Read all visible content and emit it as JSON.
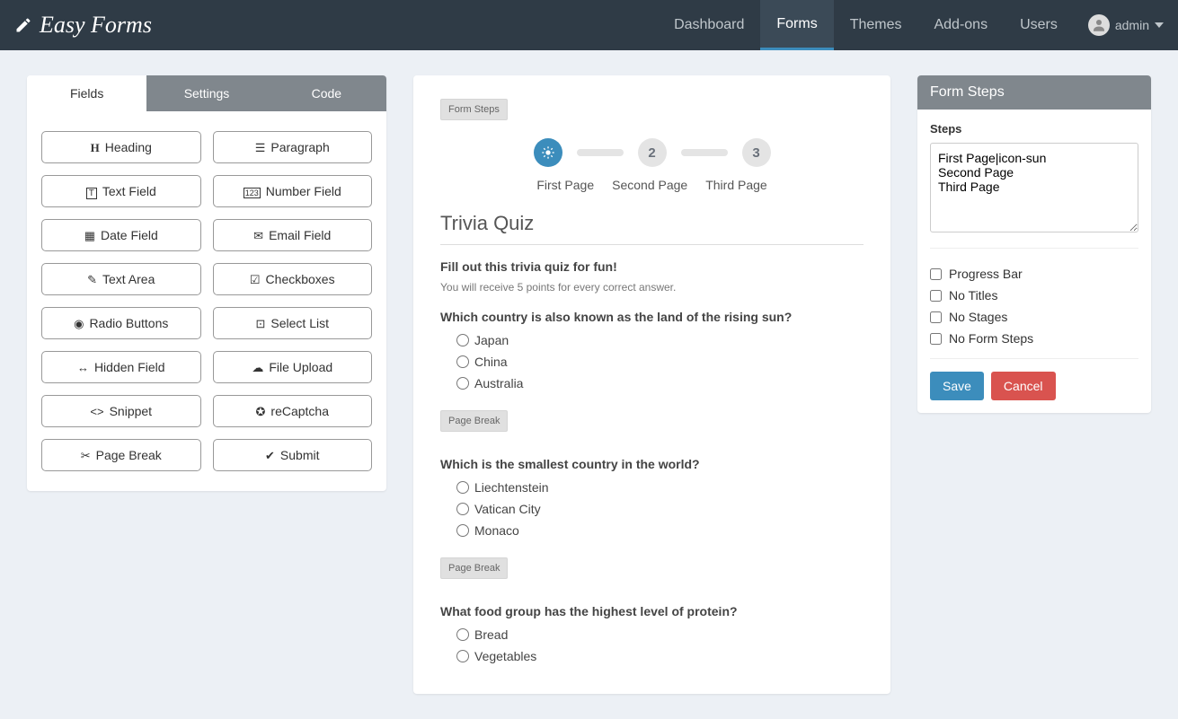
{
  "brand": "Easy Forms",
  "nav": {
    "items": [
      "Dashboard",
      "Forms",
      "Themes",
      "Add-ons",
      "Users"
    ],
    "user": "admin"
  },
  "fields_panel": {
    "tabs": [
      "Fields",
      "Settings",
      "Code"
    ],
    "fields": [
      {
        "label": "Heading",
        "icon": "heading"
      },
      {
        "label": "Paragraph",
        "icon": "paragraph"
      },
      {
        "label": "Text Field",
        "icon": "text-field"
      },
      {
        "label": "Number Field",
        "icon": "number-field"
      },
      {
        "label": "Date Field",
        "icon": "date-field"
      },
      {
        "label": "Email Field",
        "icon": "email-field"
      },
      {
        "label": "Text Area",
        "icon": "text-area"
      },
      {
        "label": "Checkboxes",
        "icon": "checkboxes"
      },
      {
        "label": "Radio Buttons",
        "icon": "radio"
      },
      {
        "label": "Select List",
        "icon": "select"
      },
      {
        "label": "Hidden Field",
        "icon": "hidden"
      },
      {
        "label": "File Upload",
        "icon": "upload"
      },
      {
        "label": "Snippet",
        "icon": "snippet"
      },
      {
        "label": "reCaptcha",
        "icon": "recaptcha"
      },
      {
        "label": "Page Break",
        "icon": "pagebreak"
      },
      {
        "label": "Submit",
        "icon": "submit"
      }
    ]
  },
  "canvas": {
    "form_steps_tag": "Form Steps",
    "steps": [
      "First Page",
      "Second Page",
      "Third Page"
    ],
    "title": "Trivia Quiz",
    "subhead": "Fill out this trivia quiz for fun!",
    "desc": "You will receive 5 points for every correct answer.",
    "page_break_label": "Page Break",
    "questions": [
      {
        "q": "Which country is also known as the land of the rising sun?",
        "options": [
          "Japan",
          "China",
          "Australia"
        ]
      },
      {
        "q": "Which is the smallest country in the world?",
        "options": [
          "Liechtenstein",
          "Vatican City",
          "Monaco"
        ]
      },
      {
        "q": "What food group has the highest level of protein?",
        "options": [
          "Bread",
          "Vegetables"
        ]
      }
    ]
  },
  "right": {
    "title": "Form Steps",
    "steps_label": "Steps",
    "textarea_value": "First Page|icon-sun\nSecond Page\nThird Page",
    "checks": [
      "Progress Bar",
      "No Titles",
      "No Stages",
      "No Form Steps"
    ],
    "save": "Save",
    "cancel": "Cancel"
  }
}
